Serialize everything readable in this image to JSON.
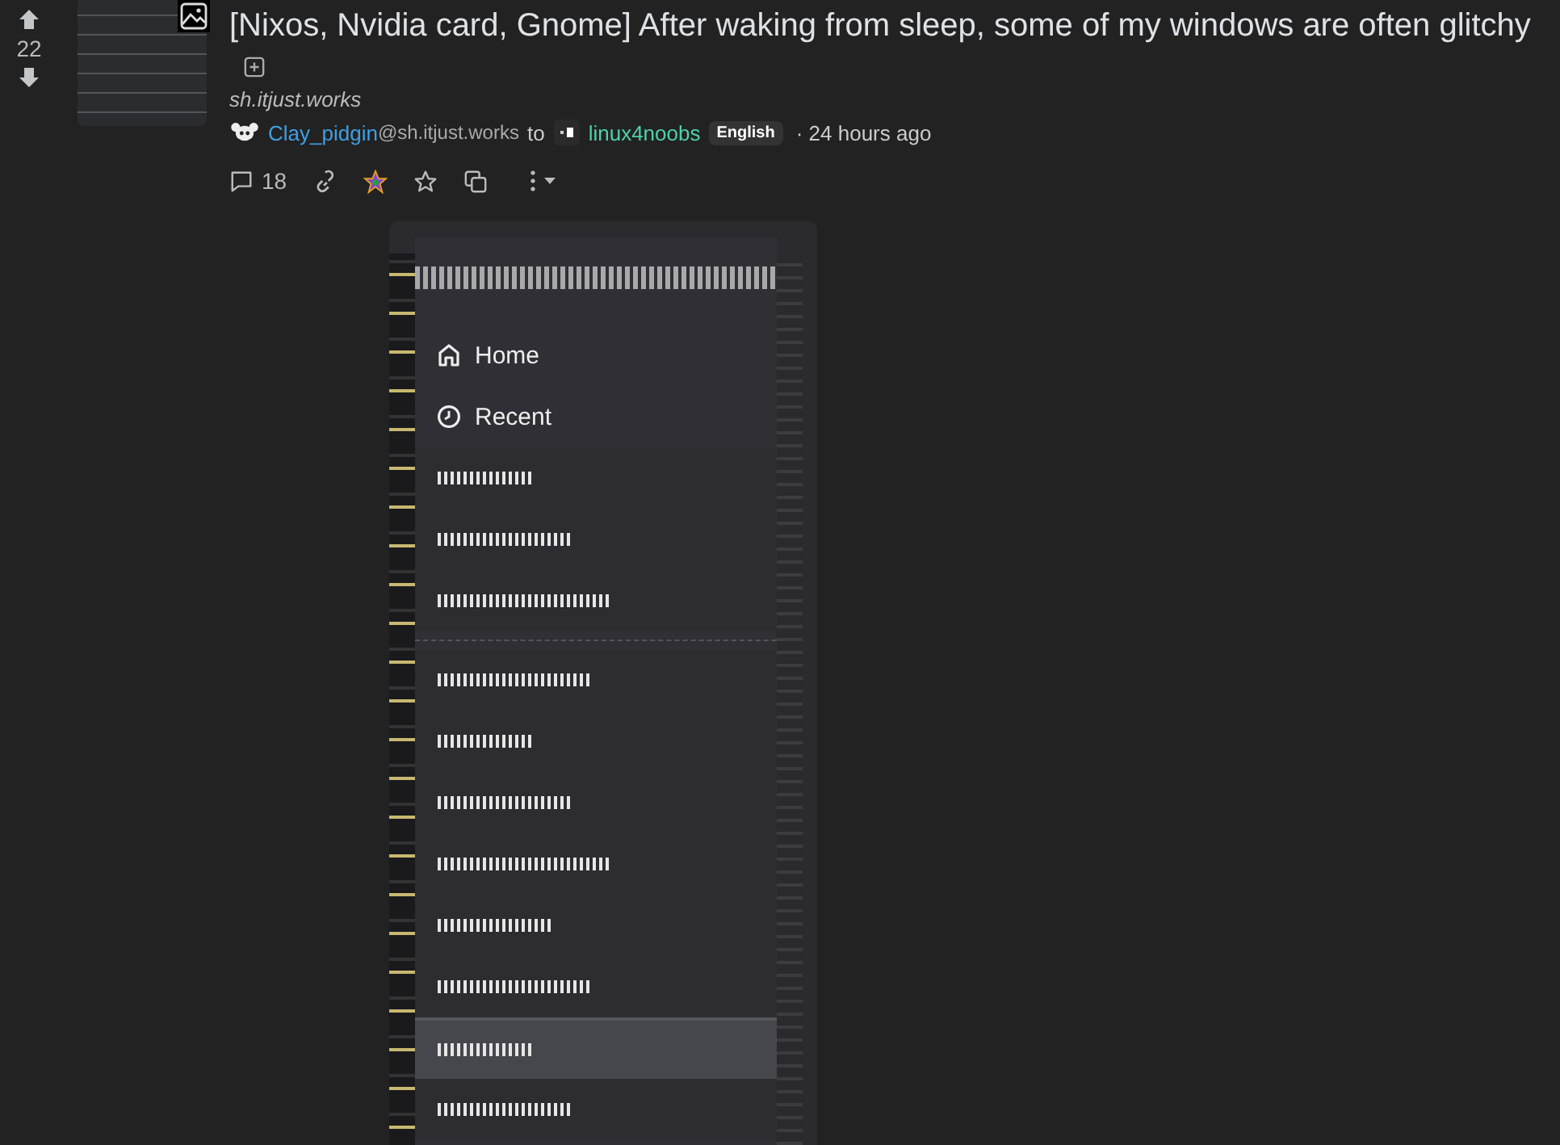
{
  "vote": {
    "score": "22"
  },
  "post": {
    "title": "[Nixos, Nvidia card, Gnome] After waking from sleep, some of my windows are often glitchy",
    "domain": "sh.itjust.works",
    "author": "Clay_pidgin",
    "author_instance": "@sh.itjust.works",
    "to": "to",
    "community": "linux4noobs",
    "language": "English",
    "time": "· 24 hours ago",
    "comments": "18"
  },
  "screenshot": {
    "menu_items": [
      {
        "label": "Home",
        "kind": "home"
      },
      {
        "label": "Recent",
        "kind": "recent"
      }
    ],
    "groups": [
      {
        "rows": [
          {
            "selected": false
          },
          {
            "selected": false
          },
          {
            "selected": false
          }
        ]
      },
      {
        "rows": [
          {
            "selected": false
          },
          {
            "selected": false
          },
          {
            "selected": false
          },
          {
            "selected": false
          },
          {
            "selected": false
          },
          {
            "selected": false
          },
          {
            "selected": true
          },
          {
            "selected": false
          }
        ]
      }
    ]
  }
}
